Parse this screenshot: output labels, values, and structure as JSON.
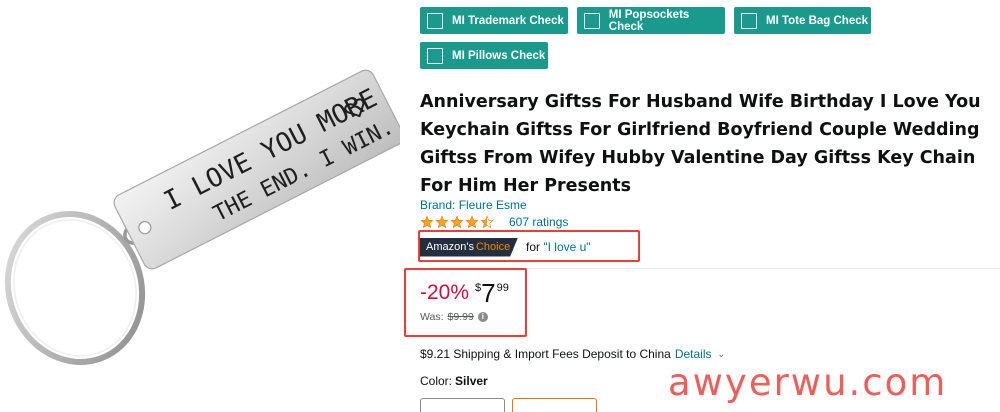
{
  "buttons": {
    "trademark": "MI Trademark Check",
    "popsockets": "MI Popsockets Check",
    "totebag": "MI Tote Bag Check",
    "pillows": "MI Pillows Check"
  },
  "product": {
    "title": "Anniversary Giftss For Husband Wife Birthday I Love You Keychain Giftss For Girlfriend Boyfriend Couple Wedding Giftss From Wifey Hubby Valentine Day Giftss Key Chain For Him Her Presents",
    "brand": "Brand: Fleure Esme",
    "rating_stars": 4.5,
    "ratings_count": "607 ratings",
    "image_text_line1": "I LOVE YOU MORE",
    "image_text_line2": "THE END. I WIN."
  },
  "badge": {
    "label_amazon": "Amazon's",
    "label_choice": "Choice",
    "for_prefix": "for ",
    "keyword": "\"I love u\""
  },
  "price": {
    "discount": "-20%",
    "currency": "$",
    "whole": "7",
    "fraction": "99",
    "was_label": "Was:",
    "was_value": "$9.99"
  },
  "shipping": {
    "text": "$9.21 Shipping & Import Fees Deposit to China",
    "details": "Details",
    "chevron": "⌄"
  },
  "color": {
    "label": "Color:",
    "value": "Silver"
  },
  "watermark": "awyerwu.com",
  "colors": {
    "button_bg": "#1a9a8c",
    "link": "#007185",
    "discount": "#cc0c39",
    "highlight_box": "#e3413a",
    "star": "#ffa41c"
  }
}
